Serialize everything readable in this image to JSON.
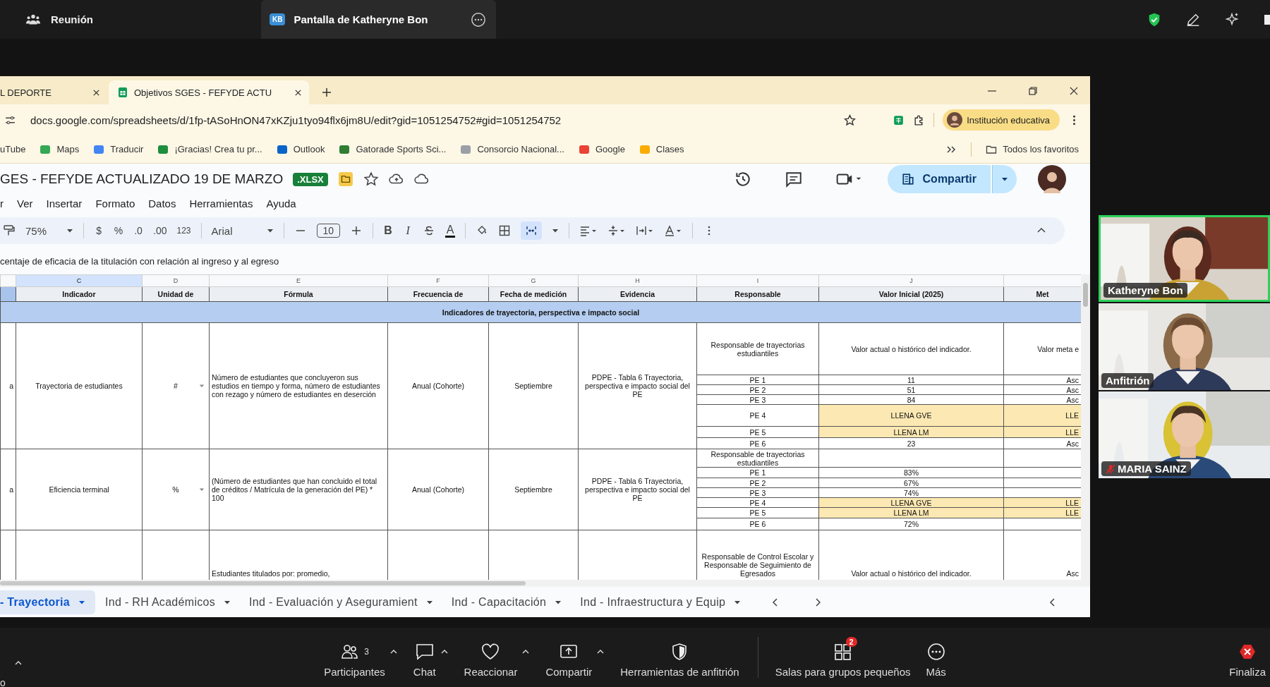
{
  "meeting": {
    "title": "Reunión",
    "share_tab": {
      "initials": "KB",
      "label": "Pantalla de Katheryne Bon",
      "selected": true
    }
  },
  "browser": {
    "tabs": [
      {
        "label": "L DEPORTE",
        "selected": false
      },
      {
        "label": "Objetivos SGES - FEFYDE ACTU",
        "selected": true
      }
    ],
    "url": "docs.google.com/spreadsheets/d/1fp-tASoHnON47xKZju1tyo94flx6jm8U/edit?gid=1051254752#gid=1051254752",
    "profile": "Institución educativa",
    "bookmarks": [
      {
        "label": "uTube"
      },
      {
        "label": "Maps",
        "color": "#34a853"
      },
      {
        "label": "Traducir",
        "color": "#4285f4"
      },
      {
        "label": "¡Gracias! Crea tu pr...",
        "color": "#1e8e3e"
      },
      {
        "label": "Outlook",
        "color": "#0a64c8"
      },
      {
        "label": "Gatorade Sports Sci...",
        "color": "#2e7d32"
      },
      {
        "label": "Consorcio Nacional...",
        "color": "#9aa0a6"
      },
      {
        "label": "Google",
        "color": "#ea4335"
      },
      {
        "label": "Clases",
        "color": "#f9ab00"
      }
    ],
    "all_bookmarks": "Todos los favoritos"
  },
  "sheet": {
    "title": "GES - FEFYDE ACTUALIZADO 19 DE MARZO",
    "file_badge": ".XLSX",
    "menu": [
      "r",
      "Ver",
      "Insertar",
      "Formato",
      "Datos",
      "Herramientas",
      "Ayuda"
    ],
    "share": "Compartir",
    "toolbar": {
      "zoom": "75%",
      "currency": "$",
      "percent": "%",
      "decrease_decimals": ".0",
      "increase_decimals": ".00",
      "number_format": "123",
      "font": "Arial",
      "font_size": "10",
      "bold": "B",
      "italic": "I",
      "text_color": "A",
      "merge_selected": true
    },
    "formula": "centaje de eficacia de la titulación con relación al ingreso y al egreso",
    "columns": [
      {
        "letter": "C",
        "heading": "Indicador",
        "selected": true
      },
      {
        "letter": "D",
        "heading": "Unidad de",
        "selected": false
      },
      {
        "letter": "E",
        "heading": "Fórmula",
        "selected": false
      },
      {
        "letter": "F",
        "heading": "Frecuencia de",
        "selected": false
      },
      {
        "letter": "G",
        "heading": "Fecha de medición",
        "selected": false
      },
      {
        "letter": "H",
        "heading": "Evidencia",
        "selected": false
      },
      {
        "letter": "I",
        "heading": "Responsable",
        "selected": false
      },
      {
        "letter": "J",
        "heading": "Valor Inicial (2025)",
        "selected": false
      },
      {
        "heading": "Met",
        "selected": false
      }
    ],
    "section": "Indicadores de trayectoria, perspectiva e impacto social",
    "rows": [
      {
        "label_cut": "a",
        "indicador": "Trayectoria de estudiantes",
        "unidad": "#",
        "formula": "Número de estudiantes que concluyeron sus estudios en tiempo y forma, número de estudiantes con rezago y número de estudiantes en deserción",
        "frecuencia": "Anual (Cohorte)",
        "fecha": "Septiembre",
        "evidencia": "PDPE - Tabla 6 Trayectoria, perspectiva e impacto social del PE",
        "entries": [
          {
            "responsable": "Responsable de trayectorias estudiantiles",
            "valor": "Valor actual o histórico del indicador.",
            "meta": "Valor meta e",
            "highlighted": false
          },
          {
            "responsable": "PE 1",
            "valor": "11",
            "meta": "Asc",
            "highlighted": false
          },
          {
            "responsable": "PE 2",
            "valor": "51",
            "meta": "Asc",
            "highlighted": false
          },
          {
            "responsable": "PE 3",
            "valor": "84",
            "meta": "Asc",
            "highlighted": false
          },
          {
            "responsable": "PE 4",
            "valor": "LLENA GVE",
            "meta": "LLE",
            "highlighted": true
          },
          {
            "responsable": "PE 5",
            "valor": "LLENA LM",
            "meta": "LLE",
            "highlighted": true
          },
          {
            "responsable": "PE 6",
            "valor": "23",
            "meta": "Asc",
            "highlighted": false
          }
        ]
      },
      {
        "label_cut": "a",
        "indicador": "Eficiencia terminal",
        "unidad": "%",
        "formula": "(Número de estudiantes que han concluido el total de créditos / Matrícula de la generación del PE) * 100",
        "frecuencia": "Anual (Cohorte)",
        "fecha": "Septiembre",
        "evidencia": "PDPE - Tabla 6 Trayectoria, perspectiva e impacto social del PE",
        "entries": [
          {
            "responsable": "Responsable de trayectorias estudiantiles",
            "highlighted": false
          },
          {
            "responsable": "PE 1",
            "valor": "83%",
            "highlighted": false
          },
          {
            "responsable": "PE 2",
            "valor": "67%",
            "highlighted": false
          },
          {
            "responsable": "PE 3",
            "valor": "74%",
            "highlighted": false
          },
          {
            "responsable": "PE 4",
            "valor": "LLENA GVE",
            "meta": "LLE",
            "highlighted": true
          },
          {
            "responsable": "PE 5",
            "valor": "LLENA LM",
            "meta": "LLE",
            "highlighted": true
          },
          {
            "responsable": "PE 6",
            "valor": "72%",
            "highlighted": false
          }
        ]
      },
      {
        "formula": "Estudiantes titulados por: promedio,",
        "entries": [
          {
            "responsable": "Responsable de Control Escolar y Responsable de Seguimiento de Egresados",
            "valor": "Valor actual o histórico del indicador.",
            "meta": "Asc",
            "highlighted": false
          }
        ]
      }
    ],
    "sheet_tabs": [
      {
        "label": "- Trayectoria",
        "selected": true
      },
      {
        "label": "Ind - RH Académicos",
        "selected": false
      },
      {
        "label": "Ind - Evaluación y Aseguramient",
        "selected": false
      },
      {
        "label": "Ind - Capacitación",
        "selected": false
      },
      {
        "label": "Ind - Infraestructura y Equip",
        "selected": false
      }
    ]
  },
  "participants": [
    {
      "name": "Katheryne Bon",
      "speaking": true,
      "muted": false
    },
    {
      "name": "Anfitrión",
      "speaking": false,
      "muted": false
    },
    {
      "name": "MARIA SAINZ",
      "speaking": false,
      "muted": true
    }
  ],
  "controls": [
    {
      "kind": "audio",
      "label": "o",
      "menu": true
    },
    {
      "kind": "participants",
      "label": "Participantes",
      "count": "3",
      "menu": true
    },
    {
      "kind": "chat",
      "label": "Chat",
      "menu": true
    },
    {
      "kind": "react",
      "label": "Reaccionar",
      "menu": true
    },
    {
      "kind": "share",
      "label": "Compartir",
      "menu": true
    },
    {
      "kind": "host",
      "label": "Herramientas de anfitrión",
      "menu": false
    },
    {
      "kind": "rooms",
      "label": "Salas para grupos pequeños",
      "badge": "2",
      "menu": false
    },
    {
      "kind": "more",
      "label": "Más",
      "menu": false
    },
    {
      "kind": "end",
      "label": "Finaliza",
      "menu": false
    }
  ]
}
